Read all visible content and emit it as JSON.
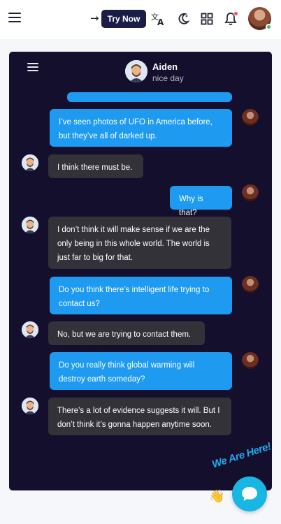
{
  "topbar": {
    "try_now_label": "Try Now",
    "icons": [
      "menu-icon",
      "arrow-right-icon",
      "translate-icon",
      "moon-icon",
      "grid-icon",
      "bell-icon",
      "user-avatar"
    ]
  },
  "chat": {
    "contact": {
      "name": "Aiden",
      "status": "nice day"
    },
    "messages": [
      {
        "from": "me",
        "text": "I’ve seen photos of UFO in America before, but they’ve all of darked up."
      },
      {
        "from": "bot",
        "text": "I think there must be."
      },
      {
        "from": "me",
        "text": "Why is that?"
      },
      {
        "from": "bot",
        "text": "I don’t think it will make sense if we are the only being in this whole world. The world is just far to big for that."
      },
      {
        "from": "me",
        "text": "Do you think there’s intelligent life trying to contact us?"
      },
      {
        "from": "bot",
        "text": "No, but we are trying to contact them."
      },
      {
        "from": "me",
        "text": "Do you really think global warming will destroy earth someday?"
      },
      {
        "from": "bot",
        "text": "There’s a lot of evidence suggests it will. But I don’t think it’s gonna happen anytime soon."
      }
    ]
  },
  "widget": {
    "label": "We Are Here!"
  },
  "colors": {
    "sent_bubble": "#1e9bf0",
    "received_bubble": "#333238",
    "chat_bg": "#130f2d",
    "try_now_bg": "#1b1d48",
    "widget": "#18b6e3"
  }
}
